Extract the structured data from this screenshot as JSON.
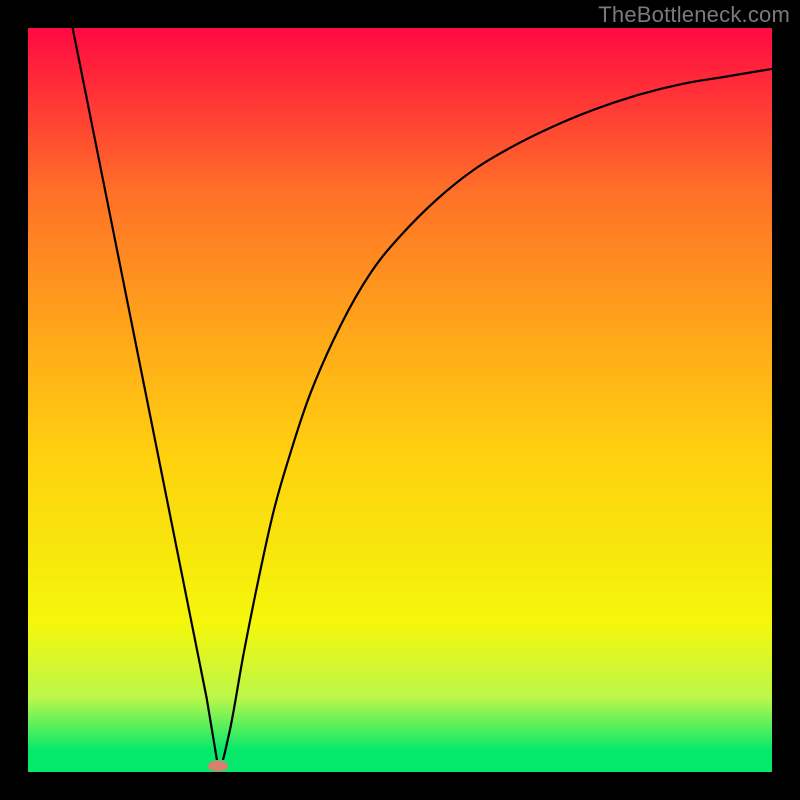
{
  "watermark": "TheBottleneck.com",
  "marker": {
    "x_frac": 0.255,
    "y_frac": 0.992
  },
  "chart_data": {
    "type": "line",
    "title": "",
    "xlabel": "",
    "ylabel": "",
    "xlim": [
      0,
      100
    ],
    "ylim": [
      0,
      100
    ],
    "series": [
      {
        "name": "bottleneck-curve",
        "x": [
          6,
          8,
          10,
          12,
          14,
          16,
          18,
          20,
          22,
          24,
          25.5,
          27,
          29,
          31,
          33,
          35,
          38,
          42,
          46,
          50,
          55,
          60,
          65,
          70,
          76,
          82,
          88,
          94,
          100
        ],
        "values": [
          100,
          90,
          80,
          70,
          60,
          50,
          40,
          30,
          20,
          10,
          1,
          5,
          16,
          26,
          35,
          42,
          51,
          60,
          67,
          72,
          77,
          81,
          84,
          86.5,
          89,
          91,
          92.5,
          93.5,
          94.5
        ]
      }
    ],
    "annotations": [
      {
        "type": "point",
        "name": "optimal-marker",
        "x": 25.5,
        "y": 1
      }
    ],
    "background": "red-to-green vertical gradient"
  }
}
